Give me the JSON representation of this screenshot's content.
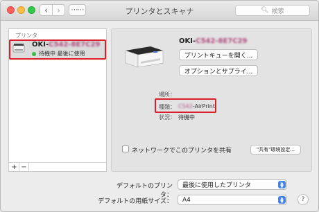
{
  "window": {
    "title": "プリンタとスキャナ",
    "search_placeholder": "検索"
  },
  "toolbar": {
    "back_glyph": "‹",
    "forward_glyph": "›",
    "grid_glyph": "⋯⋯"
  },
  "sidebar": {
    "header": "プリンタ",
    "printers": [
      {
        "name_prefix": "OKI-",
        "name_redacted": "C542-8E7C29",
        "status": "待機中 最後に使用",
        "status_color": "#3cbe49"
      }
    ],
    "add_label": "+",
    "remove_label": "−"
  },
  "detail": {
    "name_prefix": "OKI-",
    "name_redacted": "C542-8E7C29",
    "open_queue_button": "プリントキューを開く...",
    "options_button": "オプションとサプライ...",
    "location_label": "場所：",
    "location_value": "",
    "kind_label": "種類：",
    "kind_redacted": "C542",
    "kind_suffix": "-AirPrint",
    "status_label": "状況：",
    "status_value": "待機中",
    "share_label": "ネットワークでこのプリンタを共有",
    "share_checked": false,
    "sharing_prefs_button": "\"共有\"環境設定..."
  },
  "footer": {
    "default_printer_label": "デフォルトのプリンタ：",
    "default_printer_value": "最後に使用したプリンタ",
    "default_paper_label": "デフォルトの用紙サイズ：",
    "default_paper_value": "A4",
    "help_label": "?"
  },
  "colors": {
    "highlight_red": "#d9202a",
    "popup_blue": "#3b82f6"
  }
}
